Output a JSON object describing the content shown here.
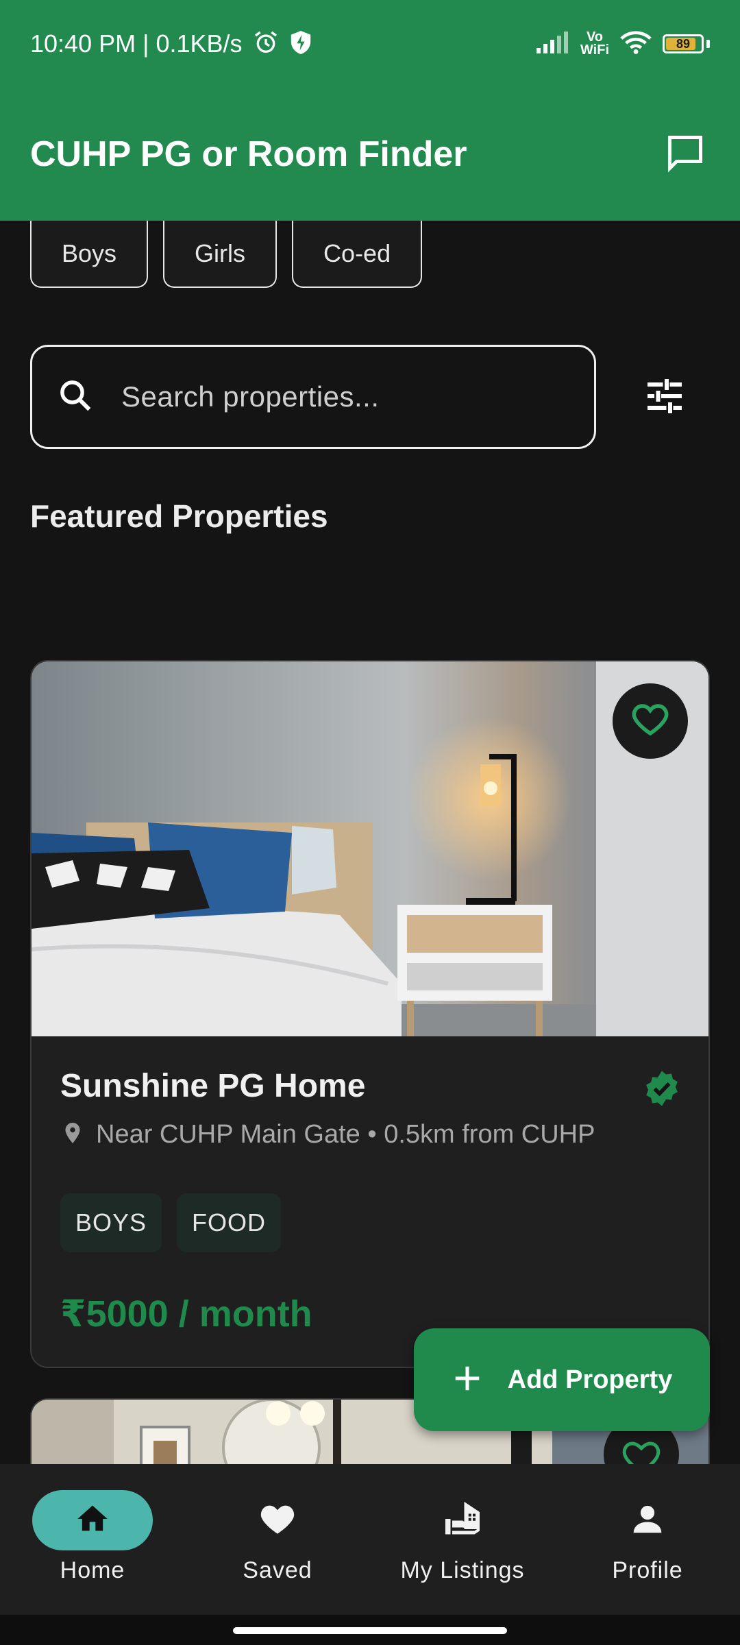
{
  "status_bar": {
    "time_speed": "10:40 PM | 0.1KB/s",
    "vowifi_line1": "Vo",
    "vowifi_line2": "WiFi",
    "battery": "89"
  },
  "app_bar": {
    "title": "CUHP PG or Room Finder"
  },
  "filters": {
    "chips": [
      "Boys",
      "Girls",
      "Co-ed"
    ]
  },
  "search": {
    "placeholder": "Search properties..."
  },
  "section": {
    "title": "Featured Properties"
  },
  "listing": {
    "title": "Sunshine PG Home",
    "location": "Near CUHP Main Gate • 0.5km from CUHP",
    "tags": [
      "BOYS",
      "FOOD"
    ],
    "price": "₹5000 / month"
  },
  "fab": {
    "label": "Add Property"
  },
  "nav": {
    "items": [
      {
        "label": "Home"
      },
      {
        "label": "Saved"
      },
      {
        "label": "My Listings"
      },
      {
        "label": "Profile"
      }
    ]
  },
  "colors": {
    "primary": "#228a4f",
    "accent": "#4db6ac",
    "price": "#1f8a4c",
    "background": "#141414"
  }
}
